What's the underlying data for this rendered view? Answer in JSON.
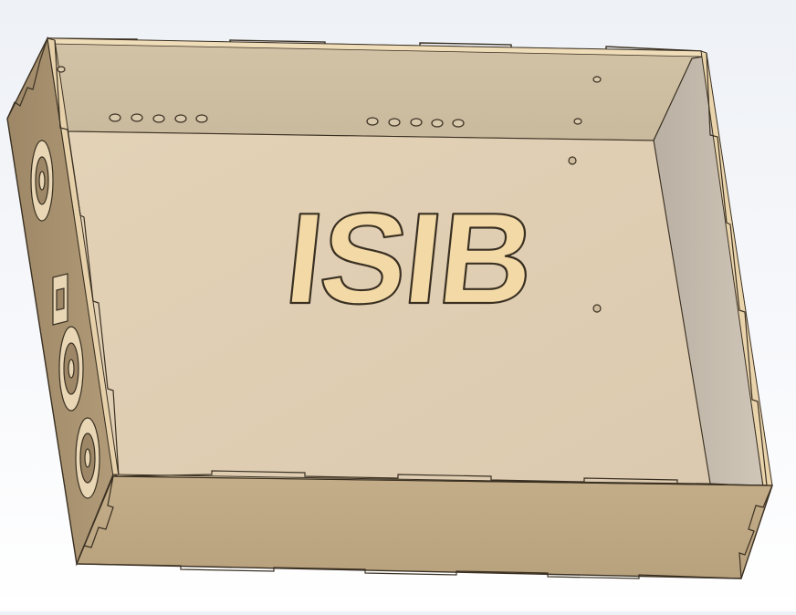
{
  "app": {
    "title": ""
  },
  "model": {
    "engraving_text": "ISIB",
    "colors": {
      "background_top": "#eef1f6",
      "background_bottom": "#ffffff",
      "wood_light": "#e5d3b6",
      "wood_floor": "#e2cfb2",
      "wood_side": "#a99271",
      "wood_front": "#bfa884",
      "wood_edge": "#f0dcb4",
      "wall_right": "#c2b8aa",
      "outline": "#3a3022"
    },
    "parts": [
      "box-floor",
      "back-wall",
      "right-wall",
      "left-wall",
      "front-wall"
    ]
  }
}
